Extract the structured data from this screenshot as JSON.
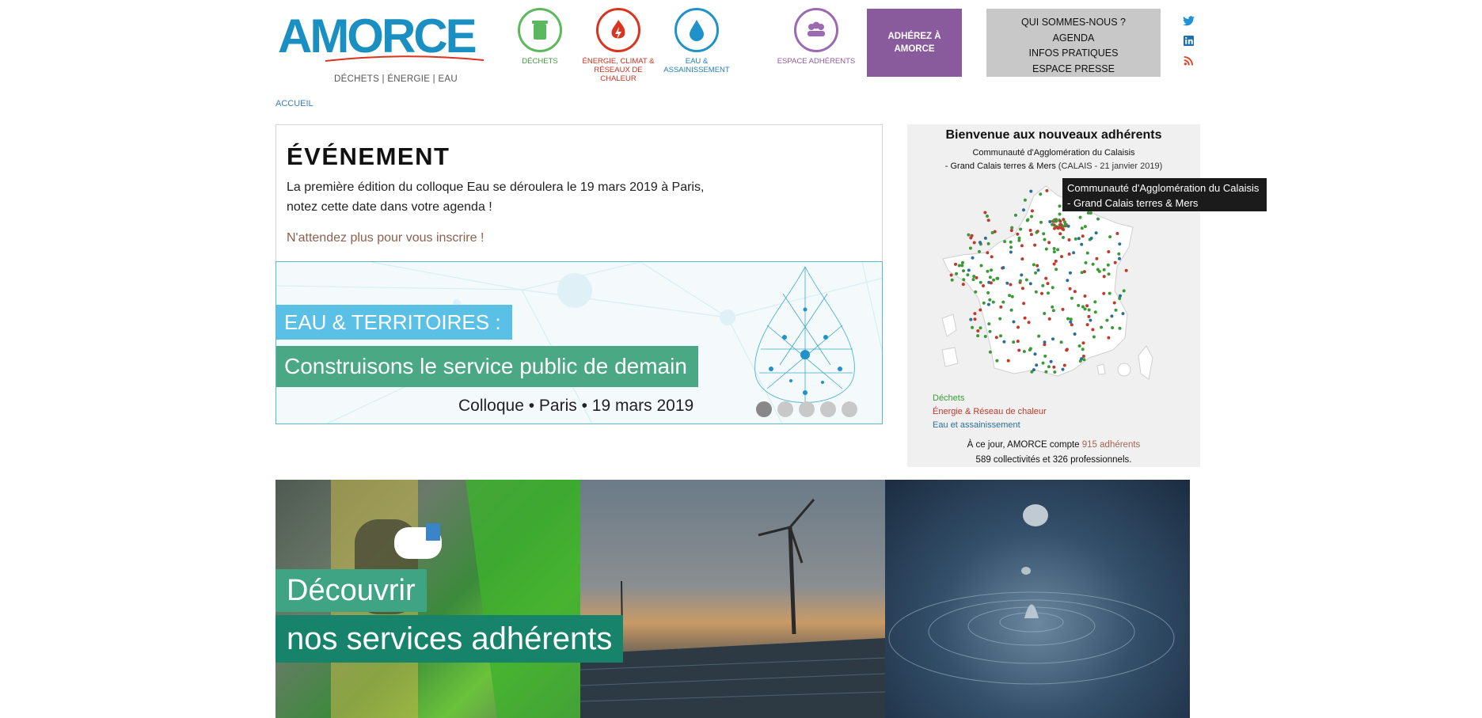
{
  "header": {
    "logo_text": "AMORCE",
    "logo_tagline": "DÉCHETS | ÉNERGIE | EAU",
    "themes": [
      {
        "label": "DÉCHETS",
        "color": "#5cb85c",
        "icon": "trash-bin-icon"
      },
      {
        "label": "ÉNERGIE, CLIMAT & RÉSEAUX DE CHALEUR",
        "color": "#d9341f",
        "icon": "flame-bolt-icon"
      },
      {
        "label": "EAU & ASSAINISSEMENT",
        "color": "#1f93c9",
        "icon": "water-drop-icon"
      },
      {
        "label": "ESPACE ADHÉRENTS",
        "color": "#9b6ab0",
        "icon": "members-icon"
      }
    ],
    "join_button": "ADHÉREZ À AMORCE",
    "menu": [
      "QUI SOMMES-NOUS ?",
      "AGENDA",
      "INFOS PRATIQUES",
      "ESPACE PRESSE"
    ],
    "social": [
      "twitter-icon",
      "linkedin-icon",
      "rss-icon"
    ]
  },
  "breadcrumb": "ACCUEIL",
  "event": {
    "heading": "ÉVÉNEMENT",
    "text": "La première édition du colloque Eau se déroulera le 19 mars 2019 à Paris, notez cette date dans votre agenda !",
    "cta": "N'attendez plus pour vous inscrire !",
    "banner_line1": "EAU & TERRITOIRES :",
    "banner_line2": "Construisons le service public de demain",
    "banner_sub": "Colloque • Paris • 19 mars 2019",
    "slider_active": 1,
    "slider_count": 5
  },
  "map": {
    "title": "Bienvenue aux nouveaux adhérents",
    "new_line1": "Communauté d'Agglomération du Calaisis",
    "new_line2": "- Grand Calais terres & Mers",
    "new_detail": "(CALAIS - 21 janvier 2019)",
    "tooltip_line1": "Communauté d'Agglomération du Calaisis",
    "tooltip_line2": "- Grand Calais terres & Mers",
    "legend": [
      {
        "label": "Déchets",
        "color": "#3a9a3a"
      },
      {
        "label": "Énergie & Réseau de chaleur",
        "color": "#c0392b"
      },
      {
        "label": "Eau et assainissement",
        "color": "#2a6f97"
      }
    ],
    "stats_prefix": "À ce jour, AMORCE compte",
    "stats_count": "915 adhérents",
    "stats_line2": "589 collectivités et 326 professionnels."
  },
  "services": {
    "line1": "Découvrir",
    "line2": "nos services adhérents"
  }
}
